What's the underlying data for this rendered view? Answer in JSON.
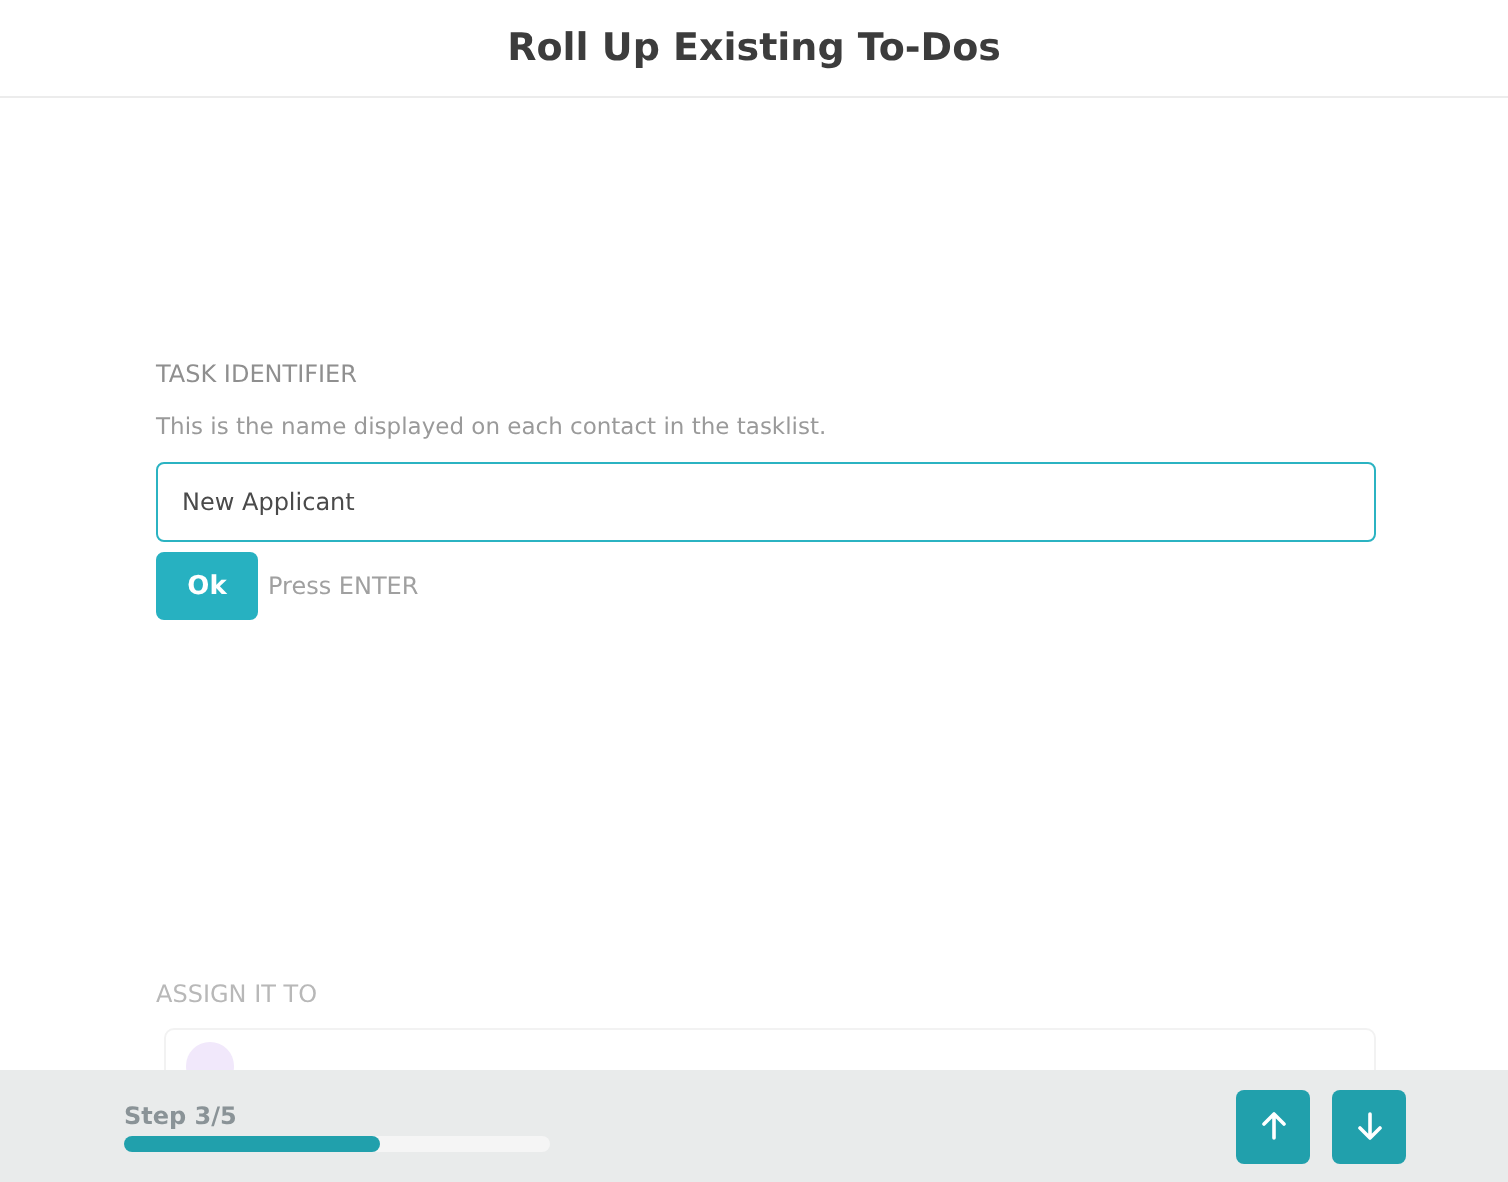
{
  "header": {
    "title": "Roll Up Existing To-Dos"
  },
  "question": {
    "label": "TASK IDENTIFIER",
    "description": "This is the name displayed on each contact in the tasklist.",
    "value": "New Applicant",
    "button": "Ok",
    "hint": "Press ENTER"
  },
  "next_question": {
    "label": "ASSIGN IT TO"
  },
  "footer": {
    "step": "Step 3/5",
    "level": 0.6
  }
}
